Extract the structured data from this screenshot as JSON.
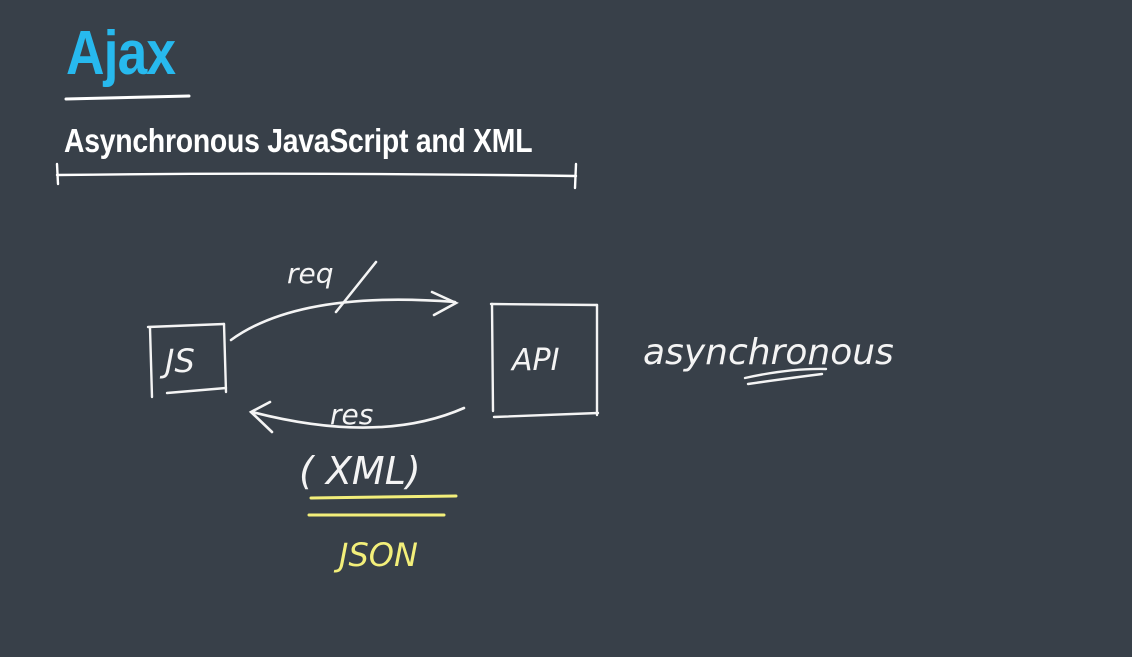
{
  "slide": {
    "title": "Ajax",
    "subtitle": "Asynchronous JavaScript and XML"
  },
  "diagram": {
    "client_label": "JS",
    "server_label": "API",
    "request_label": "req",
    "response_label": "res",
    "response_format": "( XML)",
    "alt_format": "JSON",
    "note": "asynchronous"
  },
  "colors": {
    "background": "#384049",
    "title": "#27b9ee",
    "ink": "#f4f4f4",
    "highlight": "#f3ef7a"
  }
}
